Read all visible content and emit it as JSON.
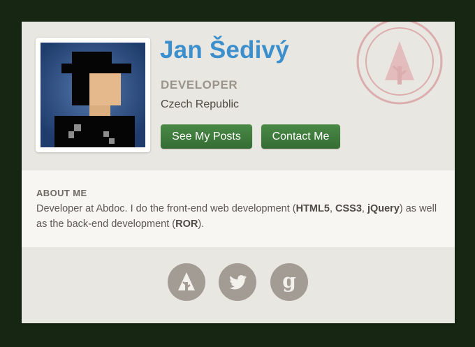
{
  "profile": {
    "name": "Jan Šedivý",
    "role": "DEVELOPER",
    "location": "Czech Republic"
  },
  "buttons": {
    "posts_label": "See My Posts",
    "contact_label": "Contact Me"
  },
  "about": {
    "title": "ABOUT ME",
    "text_1": "Developer at Abdoc. I do the front-end web development (",
    "html5": "HTML5",
    "sep_1": ", ",
    "css3": "CSS3",
    "sep_2": ", ",
    "jquery": "jQuery",
    "text_2": ") as well as the back-end development (",
    "ror": "ROR",
    "text_3": ")."
  },
  "social": [
    {
      "icon": "forrst-icon"
    },
    {
      "icon": "twitter-icon"
    },
    {
      "icon": "google-icon"
    }
  ],
  "colors": {
    "page_background": "#162613",
    "card_background": "#e9e7e1",
    "name": "#3b8fcd",
    "button": "#3e7a3d",
    "social_icon_background": "#a39c94",
    "stamp": "#d9a3a5"
  }
}
